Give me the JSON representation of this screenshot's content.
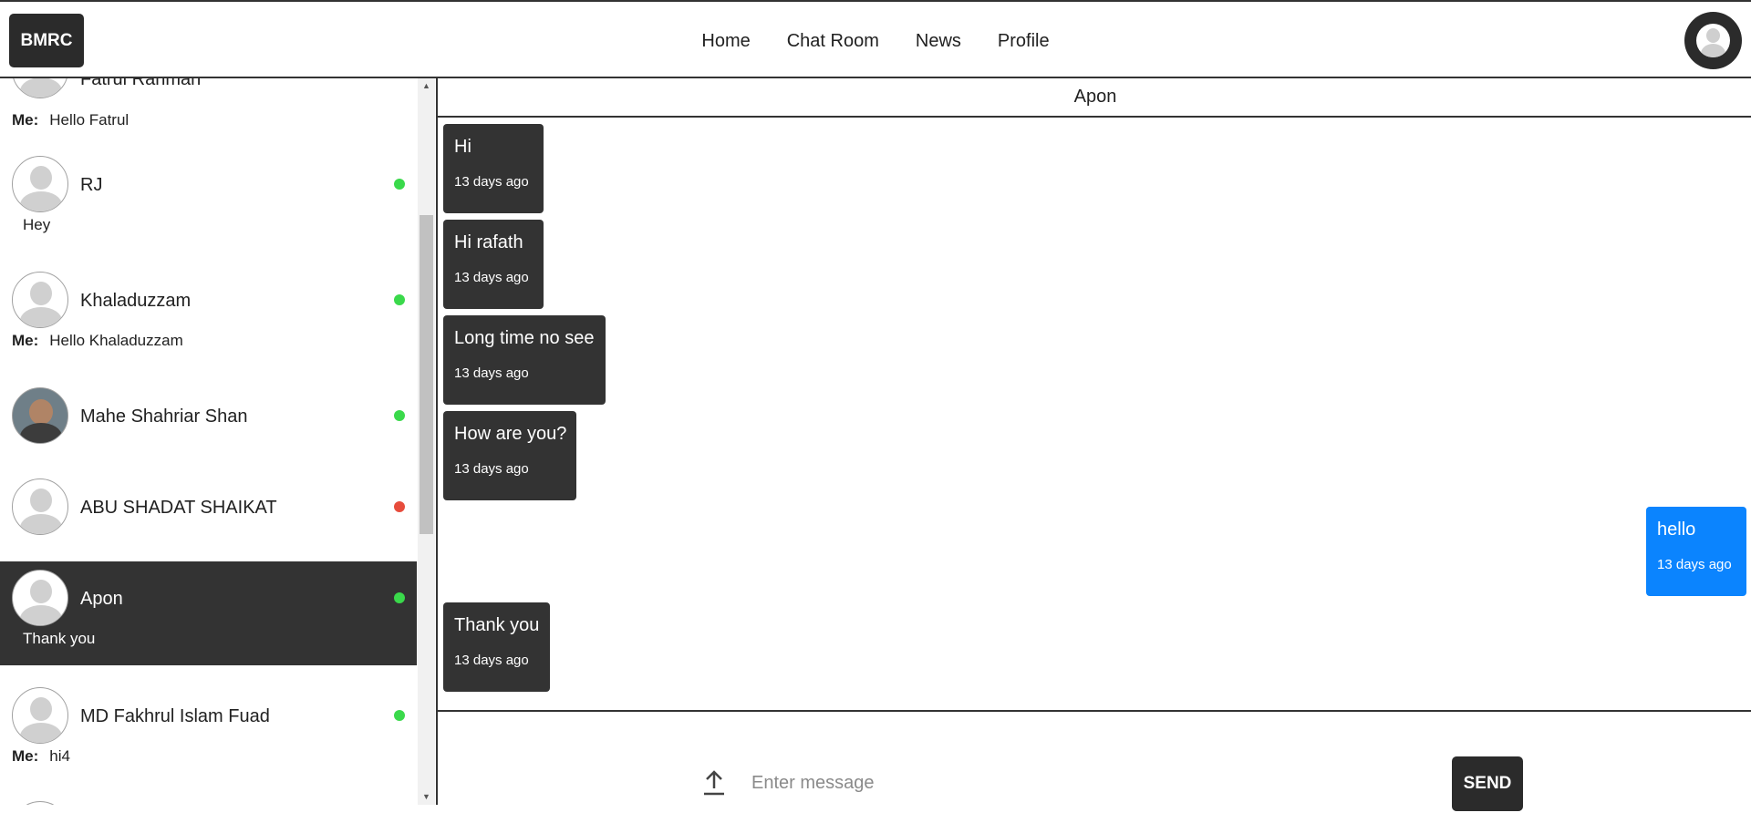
{
  "navbar": {
    "brand": "BMRC",
    "links": [
      "Home",
      "Chat Room",
      "News",
      "Profile"
    ]
  },
  "sidebar": {
    "contacts": [
      {
        "name": "Fatrul Rahman",
        "preview_prefix": "Me:",
        "preview": "Hello Fatrul",
        "status": "none"
      },
      {
        "name": "RJ",
        "preview_prefix": "",
        "preview": "Hey",
        "status": "online"
      },
      {
        "name": "Khaladuzzam",
        "preview_prefix": "Me:",
        "preview": "Hello Khaladuzzam",
        "status": "online"
      },
      {
        "name": "Mahe Shahriar Shan",
        "preview_prefix": "",
        "preview": "",
        "status": "online"
      },
      {
        "name": "ABU SHADAT SHAIKAT",
        "preview_prefix": "",
        "preview": "",
        "status": "offline"
      },
      {
        "name": "Apon",
        "preview_prefix": "",
        "preview": "Thank you",
        "status": "online",
        "active": true
      },
      {
        "name": "MD Fakhrul Islam Fuad",
        "preview_prefix": "Me:",
        "preview": "hi4",
        "status": "online"
      }
    ]
  },
  "chat": {
    "title": "Apon",
    "messages": [
      {
        "text": "Hi",
        "time": "13 days ago",
        "mine": false
      },
      {
        "text": "Hi rafath",
        "time": "13 days ago",
        "mine": false
      },
      {
        "text": "Long time no see",
        "time": "13 days ago",
        "mine": false
      },
      {
        "text": "How are you?",
        "time": "13 days ago",
        "mine": false
      },
      {
        "text": "hello",
        "time": "13 days ago",
        "mine": true
      },
      {
        "text": "Thank you",
        "time": "13 days ago",
        "mine": false
      }
    ],
    "input_placeholder": "Enter message",
    "send_label": "SEND"
  },
  "colors": {
    "dark": "#333333",
    "online": "#3ad94b",
    "offline": "#e74c3c",
    "mine_bubble": "#0b84fe"
  }
}
